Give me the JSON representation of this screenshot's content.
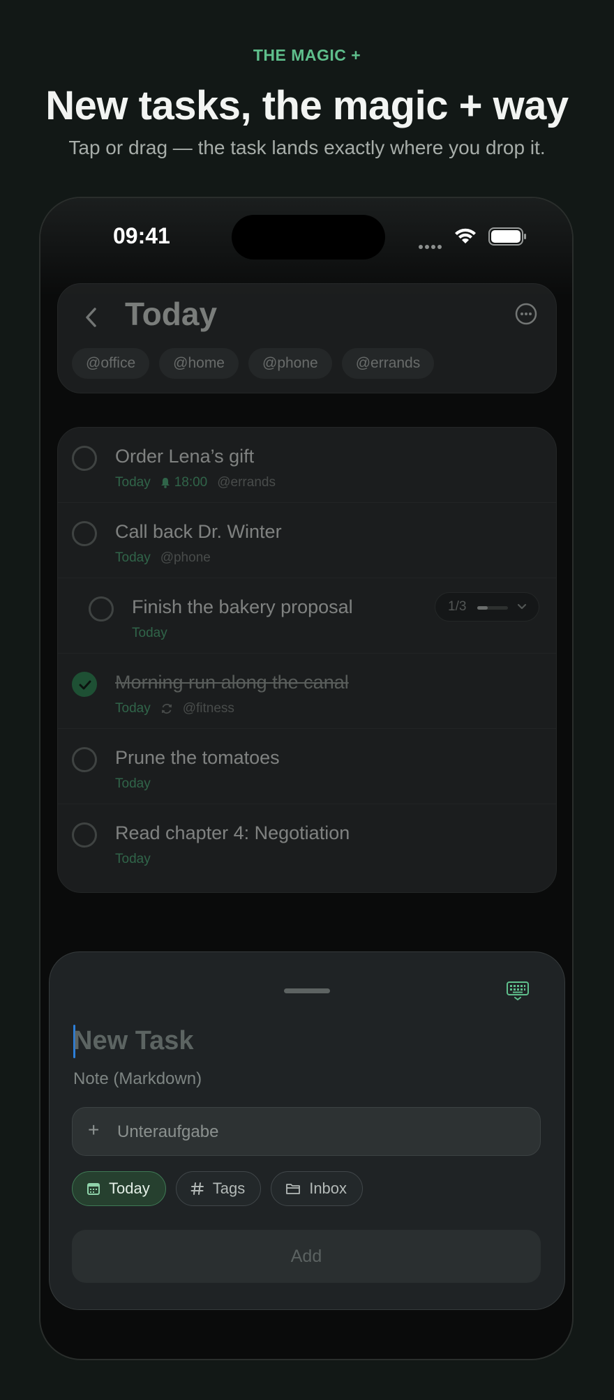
{
  "hero": {
    "eyebrow": "THE MAGIC +",
    "headline": "New tasks, the magic + way",
    "subhead": "Tap or drag — the task lands exactly where you drop it."
  },
  "status_bar": {
    "time": "09:41",
    "icons": [
      "signal-dots-icon",
      "wifi-icon",
      "battery-icon"
    ]
  },
  "header": {
    "title": "Today",
    "back_icon": "chevron-left-icon",
    "more_icon": "ellipsis-circle-icon",
    "context_chips": [
      "@office",
      "@home",
      "@phone",
      "@errands"
    ]
  },
  "tasks": [
    {
      "title": "Order Lena’s gift",
      "date": "Today",
      "time": "18:00",
      "tag": "@errands",
      "done": false
    },
    {
      "title": "Call back Dr. Winter",
      "date": "Today",
      "tag": "@phone",
      "done": false
    },
    {
      "title": "Finish the bakery proposal",
      "date": "Today",
      "subtasks": "1/3",
      "subtask_progress": 0.33,
      "done": false
    },
    {
      "title": "Morning run along the canal",
      "date": "Today",
      "repeat_icon": "repeat-icon",
      "tag": "@fitness",
      "done": true
    },
    {
      "title": "Prune the tomatoes",
      "date": "Today",
      "done": false
    },
    {
      "title": "Read chapter 4: Negotiation",
      "date": "Today",
      "done": false
    }
  ],
  "sheet": {
    "title_placeholder": "New Task",
    "note_placeholder": "Note (Markdown)",
    "subtask_placeholder": "Unteraufgabe",
    "pills": [
      {
        "label": "Today",
        "icon": "calendar-icon",
        "active": true
      },
      {
        "label": "Tags",
        "icon": "hash-icon",
        "active": false
      },
      {
        "label": "Inbox",
        "icon": "folder-icon",
        "active": false
      }
    ],
    "add_label": "Add",
    "keyboard_icon": "keyboard-icon"
  },
  "colors": {
    "accent": "#5fbf8c",
    "date_green": "#4fae7c",
    "done_green": "#2f8a57",
    "caret_blue": "#2d7fd9",
    "background": "#121816"
  }
}
